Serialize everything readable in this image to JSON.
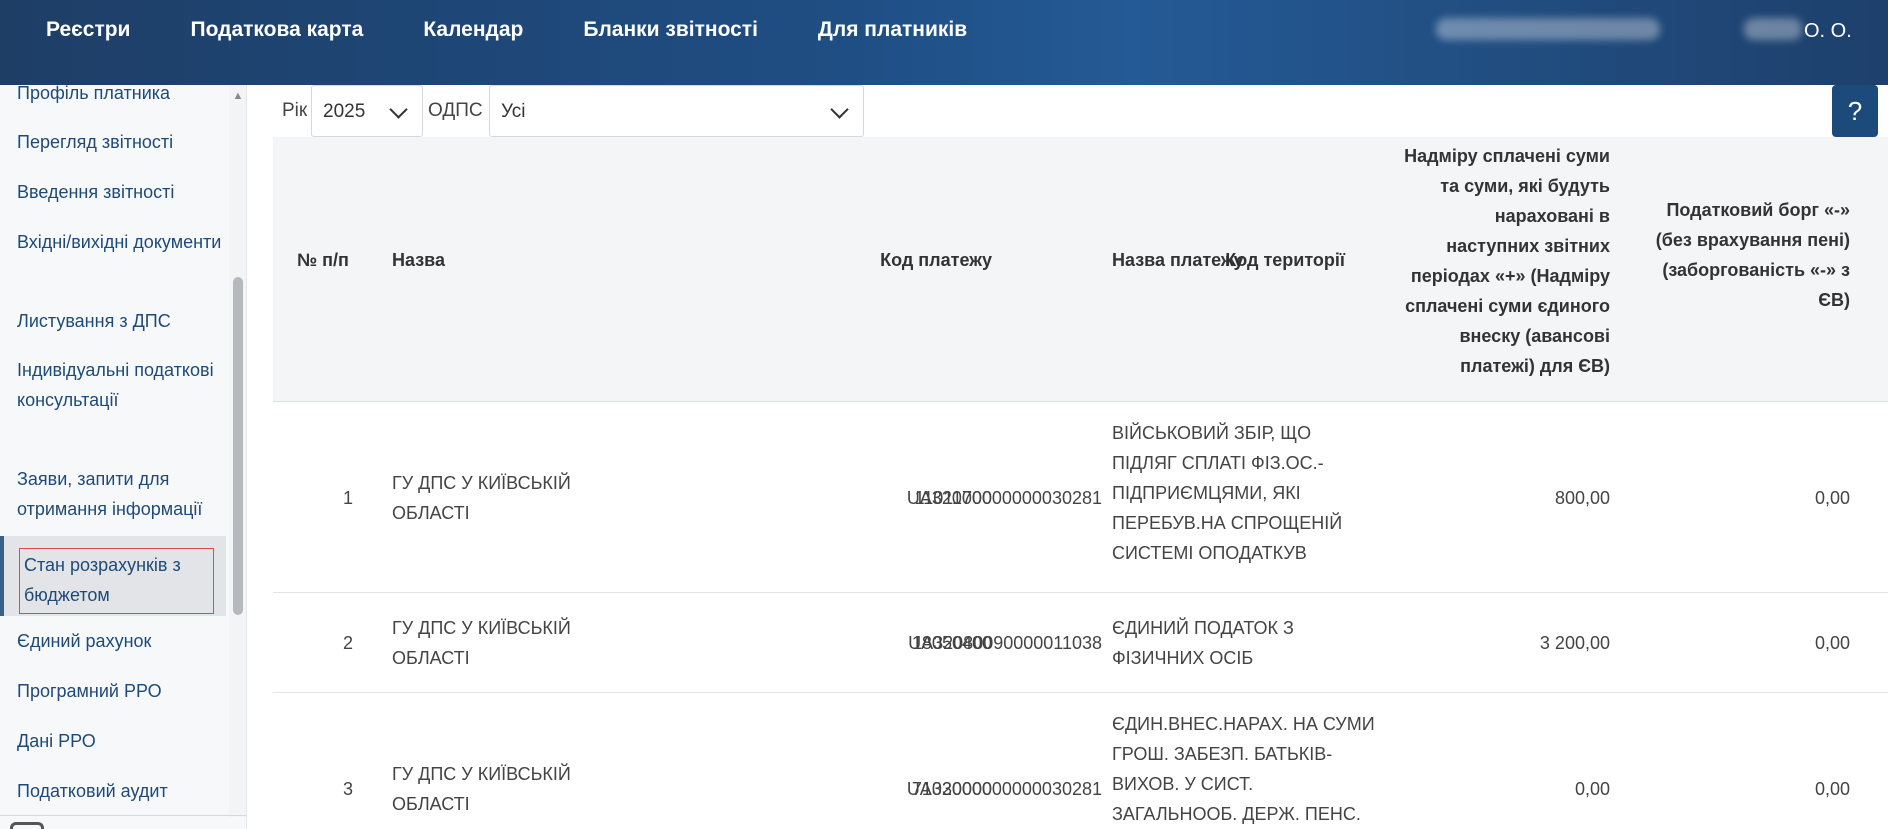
{
  "header": {
    "nav": [
      "Реєстри",
      "Податкова карта",
      "Календар",
      "Бланки звітності",
      "Для платників"
    ],
    "user_initials": "О. О."
  },
  "sidebar": {
    "items": [
      "Профіль платника",
      "Перегляд звітності",
      "Введення звітності",
      "Вхідні/вихідні документи",
      "Листування з ДПС",
      "Індивідуальні податкові консультації",
      "Заяви, запити для отримання інформації",
      "Стан розрахунків з бюджетом",
      "Єдиний рахунок",
      "Програмний РРО",
      "Дані РРО",
      "Податковий аудит"
    ],
    "active_index": 7
  },
  "filters": {
    "year_label": "Рік",
    "year_value": "2025",
    "odps_label": "ОДПС",
    "odps_value": "Усі"
  },
  "help_label": "?",
  "table": {
    "columns": [
      "№ п/п",
      "Назва",
      "Код платежу",
      "Код території",
      "Назва платежу",
      "Надміру сплачені суми та суми, які будуть нараховані в наступних звітних періодах «+» (Надміру сплачені суми єдиного внеску (авансові платежі) для ЄВ)",
      "Податковий борг «-» (без врахування пені) (заборгованість «-» з ЄВ)"
    ],
    "rows": [
      {
        "num": "1",
        "name": "ГУ ДПС У КИЇВСЬКІЙ ОБЛАСТІ",
        "payment_code": "11011700",
        "territory_code": "UA32000000000030281",
        "payment_name": "ВІЙСЬКОВИЙ ЗБІР, ЩО ПІДЛЯГ СПЛАТІ ФІЗ.ОС.-ПІДПРИЄМЦЯМИ, ЯКІ ПЕРЕБУВ.НА СПРОЩЕНІЙ СИСТЕМІ ОПОДАТКУВ",
        "overpaid": "800,00",
        "debt": "0,00"
      },
      {
        "num": "2",
        "name": "ГУ ДПС У КИЇВСЬКІЙ ОБЛАСТІ",
        "payment_code": "18050400",
        "territory_code": "UA32080090000011038",
        "payment_name": "ЄДИНИЙ ПОДАТОК З ФІЗИЧНИХ ОСІБ",
        "overpaid": "3 200,00",
        "debt": "0,00"
      },
      {
        "num": "3",
        "name": "ГУ ДПС У КИЇВСЬКІЙ ОБЛАСТІ",
        "payment_code": "71030000",
        "territory_code": "UA32000000000030281",
        "payment_name": "ЄДИН.ВНЕС.НАРАХ. НА СУМИ ГРОШ. ЗАБЕЗП. БАТЬКІВ-ВИХОВ. У СИСТ. ЗАГАЛЬНООБ. ДЕРЖ. ПЕНС.",
        "overpaid": "0,00",
        "debt": "0,00"
      }
    ]
  }
}
